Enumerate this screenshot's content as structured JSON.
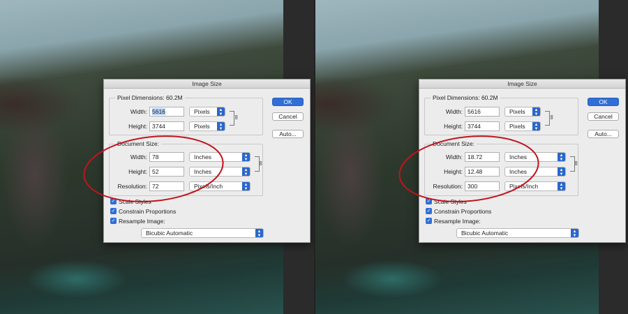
{
  "panels": [
    {
      "title": "Image Size",
      "pixel_dimensions_label": "Pixel Dimensions:",
      "pixel_dimensions_value": "60.2M",
      "width_label": "Width:",
      "height_label": "Height:",
      "resolution_label": "Resolution:",
      "px_width": "5616",
      "px_height": "3744",
      "px_width_unit": "Pixels",
      "px_height_unit": "Pixels",
      "document_size_label": "Document Size:",
      "doc_width": "78",
      "doc_height": "52",
      "resolution": "72",
      "doc_width_unit": "Inches",
      "doc_height_unit": "Inches",
      "resolution_unit": "Pixels/Inch",
      "scale_styles": "Scale Styles",
      "constrain": "Constrain Proportions",
      "resample": "Resample Image:",
      "resample_method": "Bicubic Automatic",
      "ok": "OK",
      "cancel": "Cancel",
      "auto": "Auto..."
    },
    {
      "title": "Image Size",
      "pixel_dimensions_label": "Pixel Dimensions:",
      "pixel_dimensions_value": "60.2M",
      "width_label": "Width:",
      "height_label": "Height:",
      "resolution_label": "Resolution:",
      "px_width": "5616",
      "px_height": "3744",
      "px_width_unit": "Pixels",
      "px_height_unit": "Pixels",
      "document_size_label": "Document Size:",
      "doc_width": "18.72",
      "doc_height": "12.48",
      "resolution": "300",
      "doc_width_unit": "Inches",
      "doc_height_unit": "Inches",
      "resolution_unit": "Pixels/Inch",
      "scale_styles": "Scale Styles",
      "constrain": "Constrain Proportions",
      "resample": "Resample Image:",
      "resample_method": "Bicubic Automatic",
      "ok": "OK",
      "cancel": "Cancel",
      "auto": "Auto..."
    }
  ],
  "colors": {
    "accent": "#2f6fd6",
    "annotation": "#c0141e"
  }
}
